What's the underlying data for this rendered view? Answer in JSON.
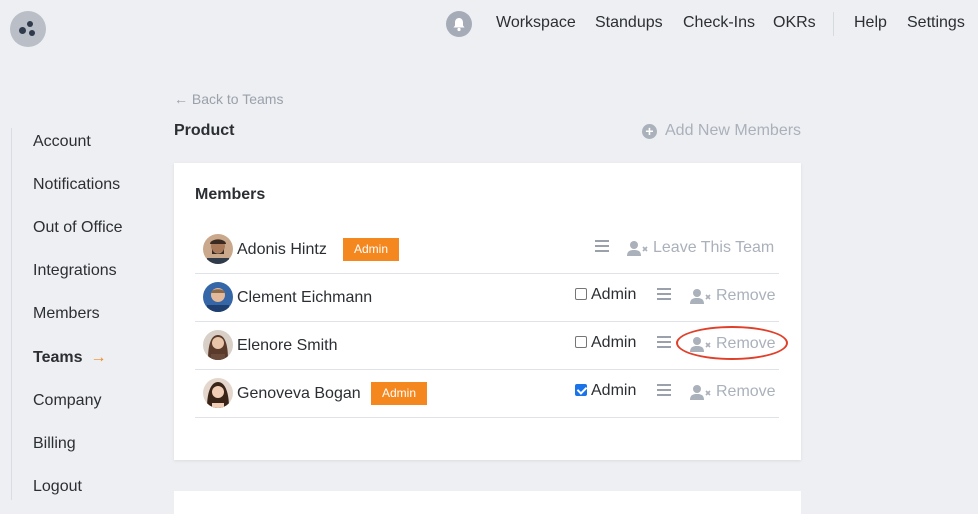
{
  "topbar": {
    "nav": [
      "Workspace",
      "Standups",
      "Check-Ins",
      "OKRs"
    ],
    "help": "Help",
    "settings": "Settings"
  },
  "sidebar": {
    "items": [
      {
        "label": "Account"
      },
      {
        "label": "Notifications"
      },
      {
        "label": "Out of Office"
      },
      {
        "label": "Integrations"
      },
      {
        "label": "Members"
      },
      {
        "label": "Teams",
        "active": true,
        "arrow": "→"
      },
      {
        "label": "Company"
      },
      {
        "label": "Billing"
      },
      {
        "label": "Logout"
      }
    ]
  },
  "main": {
    "back_link": "← Back to Teams",
    "team_name": "Product",
    "add_members": "Add New Members",
    "card_title": "Members",
    "members": [
      {
        "name": "Adonis Hintz",
        "badge": "Admin",
        "action": "Leave This Team"
      },
      {
        "name": "Clement Eichmann",
        "admin_label": "Admin",
        "admin_checked": false,
        "action": "Remove"
      },
      {
        "name": "Elenore Smith",
        "admin_label": "Admin",
        "admin_checked": false,
        "action": "Remove"
      },
      {
        "name": "Genoveva Bogan",
        "badge": "Admin",
        "admin_label": "Admin",
        "admin_checked": true,
        "action": "Remove"
      }
    ]
  },
  "colors": {
    "accent": "#f5871f",
    "highlight": "#e0402a",
    "muted": "#aab1bb"
  }
}
